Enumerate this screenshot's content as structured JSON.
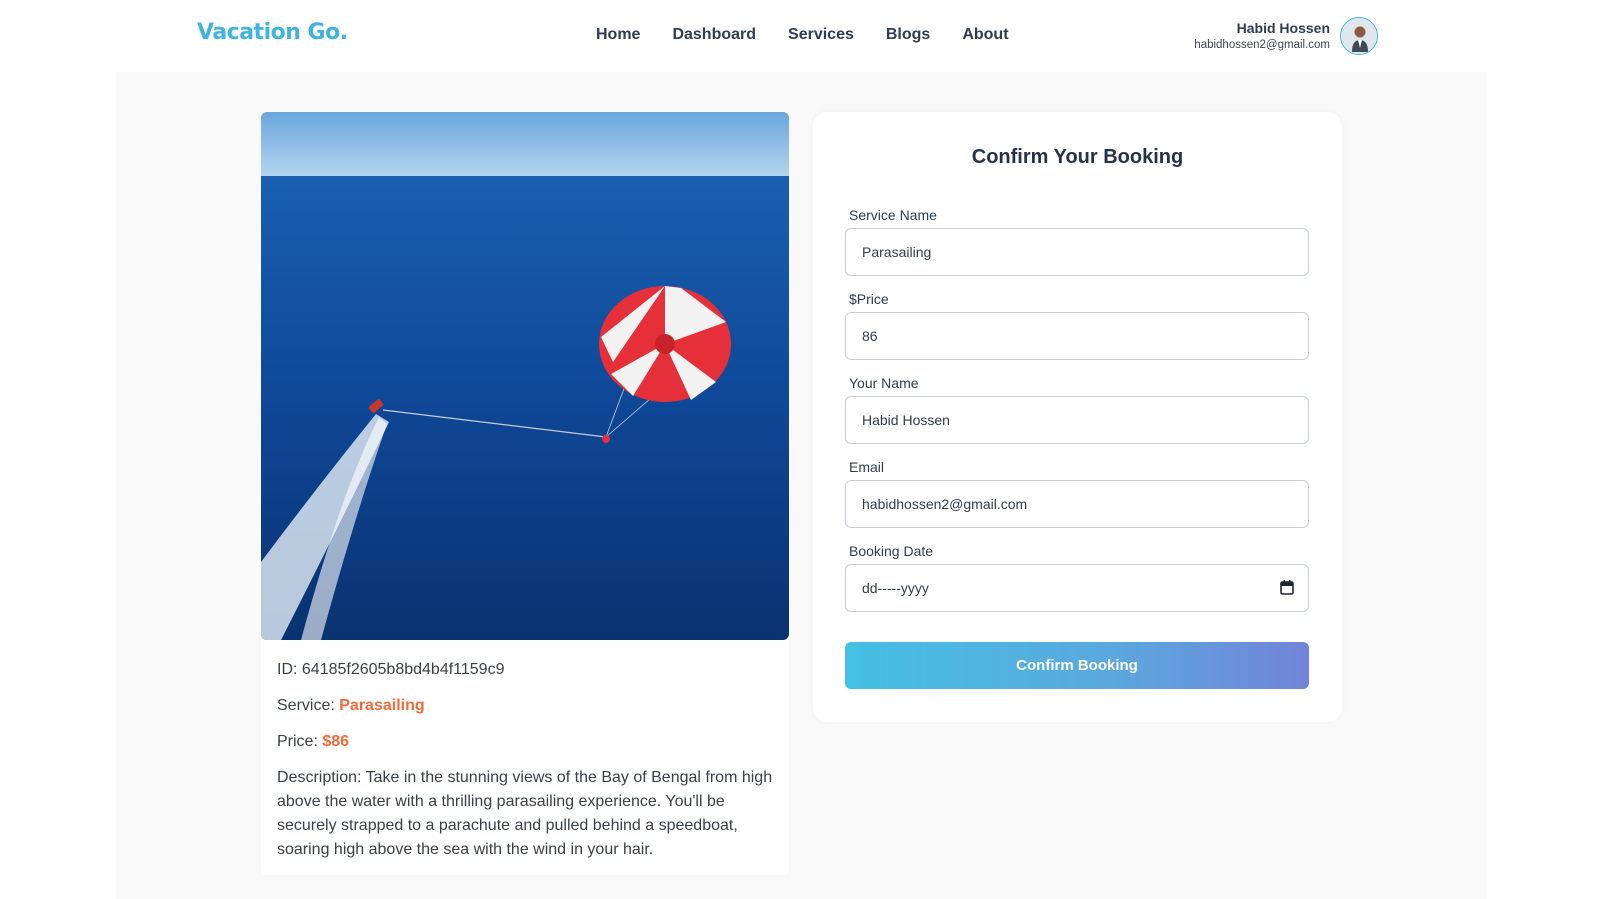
{
  "header": {
    "logo": "Vacation Go.",
    "nav": [
      "Home",
      "Dashboard",
      "Services",
      "Blogs",
      "About"
    ],
    "user_name": "Habid Hossen",
    "user_email": "habidhossen2@gmail.com"
  },
  "service": {
    "image_alt": "Parasailing over blue sea",
    "id_label": "ID: ",
    "id": "64185f2605b8bd4b4f1159c9",
    "service_label": "Service: ",
    "service_name": "Parasailing",
    "price_label": "Price: ",
    "price": "$86",
    "description": "Description: Take in the stunning views of the Bay of Bengal from high above the water with a thrilling parasailing experience. You'll be securely strapped to a parachute and pulled behind a speedboat, soaring high above the sea with the wind in your hair."
  },
  "form": {
    "title": "Confirm Your Booking",
    "service_name_label": "Service Name",
    "service_name_value": "Parasailing",
    "price_label": "$Price",
    "price_value": "86",
    "your_name_label": "Your Name",
    "your_name_value": "Habid Hossen",
    "email_label": "Email",
    "email_value": "habidhossen2@gmail.com",
    "booking_date_label": "Booking Date",
    "booking_date_placeholder": "dd-----yyyy",
    "submit_label": "Confirm Booking"
  },
  "colors": {
    "brand": "#41b3e3",
    "accent": "#f26b3a",
    "button_gradient_start": "#44c0e3",
    "button_gradient_end": "#7284d8"
  }
}
